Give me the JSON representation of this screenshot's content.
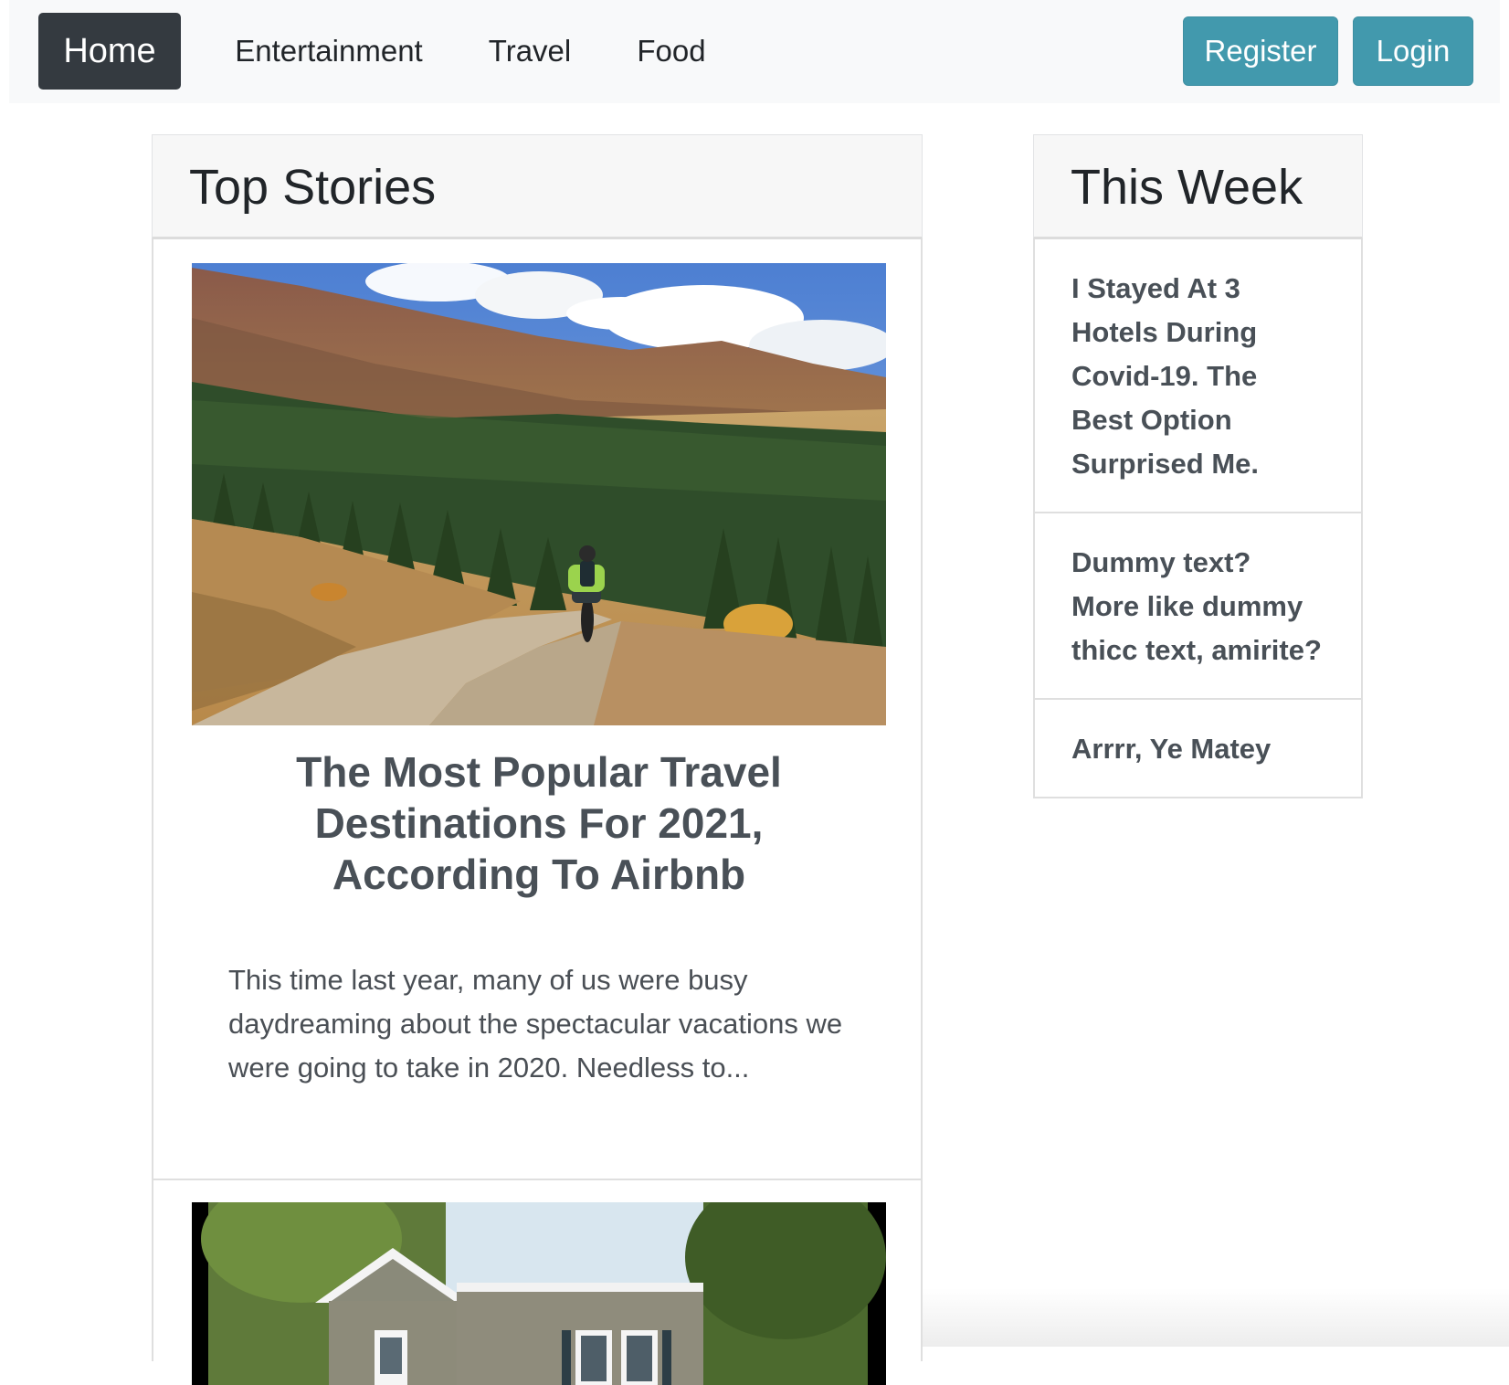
{
  "navbar": {
    "home": "Home",
    "entertainment": "Entertainment",
    "travel": "Travel",
    "food": "Food",
    "register": "Register",
    "login": "Login",
    "accent_color": "#4299ad",
    "active_color": "#343a40"
  },
  "top_stories": {
    "heading": "Top Stories",
    "stories": [
      {
        "title": "The Most Popular Travel Destinations For 2021, According To Airbnb",
        "excerpt": "This time last year, many of us were busy daydreaming about the spectacular vacations we were going to take in 2020. Needless to..."
      }
    ]
  },
  "this_week": {
    "heading": "This Week",
    "items": [
      "I Stayed At 3 Hotels During Covid-19. The Best Option Surprised Me.",
      "Dummy text? More like dummy thicc text, amirite?",
      "Arrrr, Ye Matey"
    ]
  }
}
